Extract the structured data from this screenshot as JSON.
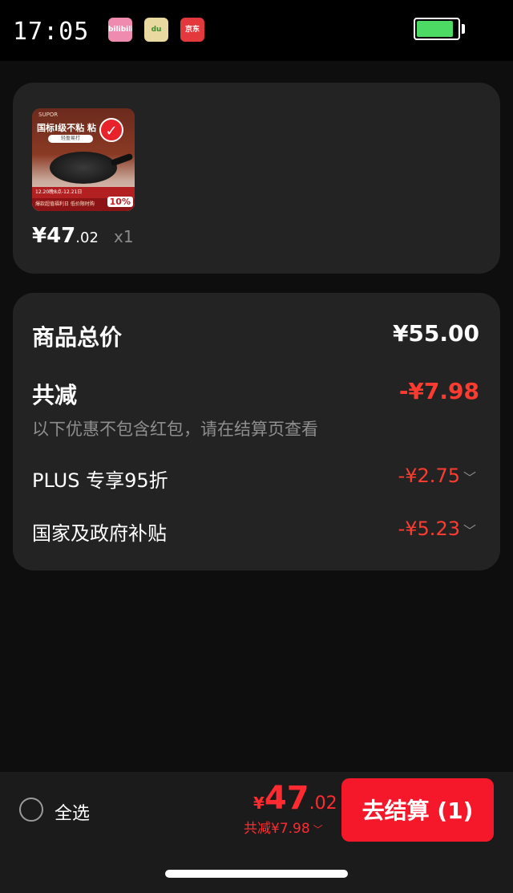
{
  "status_bar": {
    "time": "17:05",
    "apps": [
      {
        "name": "bilibili",
        "icon": "bilibili-icon",
        "label": "bilibili"
      },
      {
        "name": "dewu",
        "icon": "dewu-icon",
        "label": "du"
      },
      {
        "name": "jd",
        "icon": "jd-icon",
        "label": "京东"
      }
    ],
    "battery_level": 0.9
  },
  "item": {
    "thumb_logo": "SUPOR",
    "thumb_banner": "国标I级不粘 粘",
    "thumb_sub": "轻盈易打",
    "thumb_date": "12.20晚8点-12.21日",
    "thumb_promo": "爆款超值福利日 低价限时购",
    "thumb_discount": "10%",
    "check_mark": "✓",
    "price_int": "¥47",
    "price_dec": ".02",
    "quantity": "x1"
  },
  "summary": {
    "total_label": "商品总价",
    "total_value": "¥55.00",
    "reduce_label": "共减",
    "reduce_value": "-¥7.98",
    "note": "以下优惠不包含红包，请在结算页查看",
    "discounts": [
      {
        "label": "PLUS 专享95折",
        "value": "-¥2.75"
      },
      {
        "label": "国家及政府补贴",
        "value": "-¥5.23"
      }
    ]
  },
  "bottom": {
    "select_all": "全选",
    "pay_currency": "¥",
    "pay_int": "47",
    "pay_dec": ".02",
    "pay_save": "共减¥7.98",
    "checkout": "去结算 (1)"
  },
  "colors": {
    "accent": "#ff2b30",
    "button": "#f5182a",
    "card": "#232323",
    "background": "#0e0e0e"
  }
}
